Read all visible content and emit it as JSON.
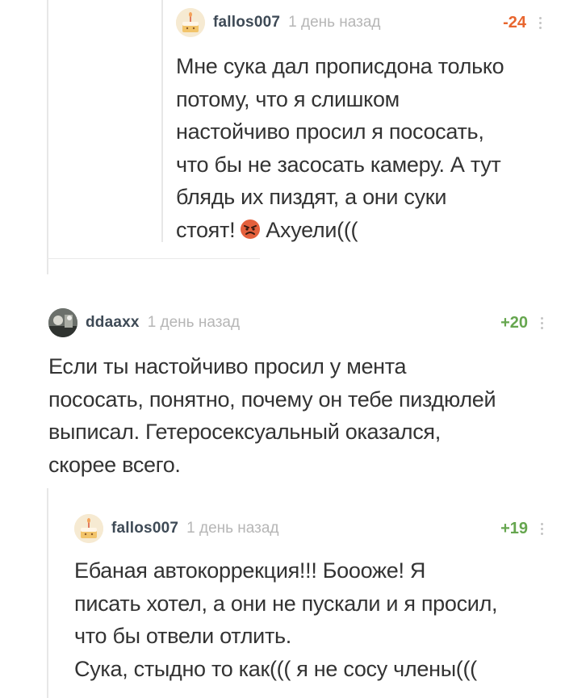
{
  "comments": [
    {
      "username": "fallos007",
      "time": "1 день назад",
      "rating": "-24",
      "text_before_emoji": "Мне сука дал прописдона только\nпотому, что я слишком\nнастойчиво просил я пососать,\nчто бы не засосать камеру. А тут\nблядь их пиздят, а они суки\nстоят!",
      "text_after_emoji": "Ахуели(((",
      "avatar_icon": "cake-avatar-icon",
      "emoji_icon": "angry-face-emoji-icon"
    },
    {
      "username": "ddaaxx",
      "time": "1 день назад",
      "rating": "+20",
      "text": "Если ты настойчиво просил у мента\nпососать, понятно, почему он тебе пиздюлей\nвыписал. Гетеросексуальный оказался,\nскорее всего.",
      "avatar_icon": "photo-avatar-icon"
    },
    {
      "username": "fallos007",
      "time": "1 день назад",
      "rating": "+19",
      "text": "Ебаная автокоррекция!!! Боооже! Я\nписать хотел, а они не пускали и я просил,\nчто бы отвели отлить.\nСука, стыдно то как((( я не сосу члены(((",
      "avatar_icon": "cake-avatar-icon"
    }
  ],
  "colors": {
    "negative_rating": "#e8662f",
    "positive_rating": "#66a64f",
    "username": "#3e4a56",
    "timestamp": "#b6b6b6",
    "thread_line": "#e7e7e7"
  }
}
